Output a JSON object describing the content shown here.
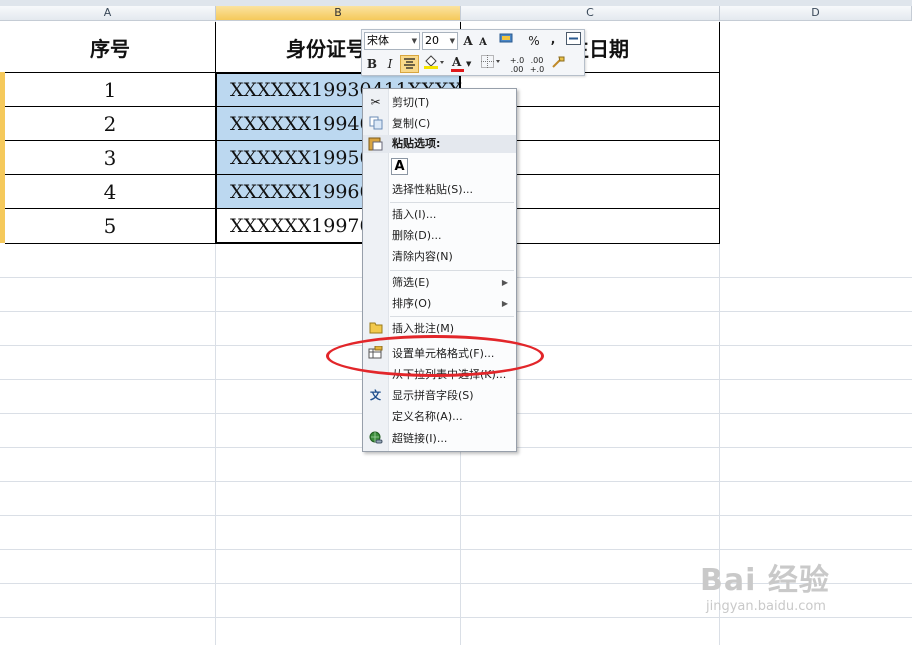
{
  "columns": [
    "A",
    "B",
    "C",
    "D"
  ],
  "table": {
    "headers": [
      "序号",
      "身份证号",
      "生日期"
    ],
    "rows": [
      {
        "no": "1",
        "id": "XXXXXX19930411XXXX"
      },
      {
        "no": "2",
        "id": "XXXXXX19940"
      },
      {
        "no": "3",
        "id": "XXXXXX19950"
      },
      {
        "no": "4",
        "id": "XXXXXX19960"
      },
      {
        "no": "5",
        "id": "XXXXXX19970"
      }
    ]
  },
  "mini_toolbar": {
    "font": "宋体",
    "size": "20",
    "grow": "A",
    "shrink": "A",
    "percent": "%",
    "comma": ",",
    "bold": "B",
    "italic": "I",
    "font_color": "A",
    "inc_decimal": "+.0 .00",
    "dec_decimal": ".00 +.0"
  },
  "context_menu": {
    "cut": "剪切(T)",
    "copy": "复制(C)",
    "paste_options": "粘贴选项:",
    "paste_icon": "A",
    "paste_special": "选择性粘贴(S)...",
    "insert": "插入(I)...",
    "delete": "删除(D)...",
    "clear": "清除内容(N)",
    "filter": "筛选(E)",
    "sort": "排序(O)",
    "insert_comment": "插入批注(M)",
    "format_cells": "设置单元格格式(F)...",
    "pick_list": "从下拉列表中选择(K)...",
    "phonetic": "显示拼音字段(S)",
    "define_name": "定义名称(A)...",
    "hyperlink": "超链接(I)..."
  },
  "watermark": {
    "brand": "Bai 经验",
    "url": "jingyan.baidu.com"
  },
  "colors": {
    "selection": "#bcd8f0",
    "highlight_ring": "#e2262a",
    "header_selected": "#f5c95b"
  }
}
